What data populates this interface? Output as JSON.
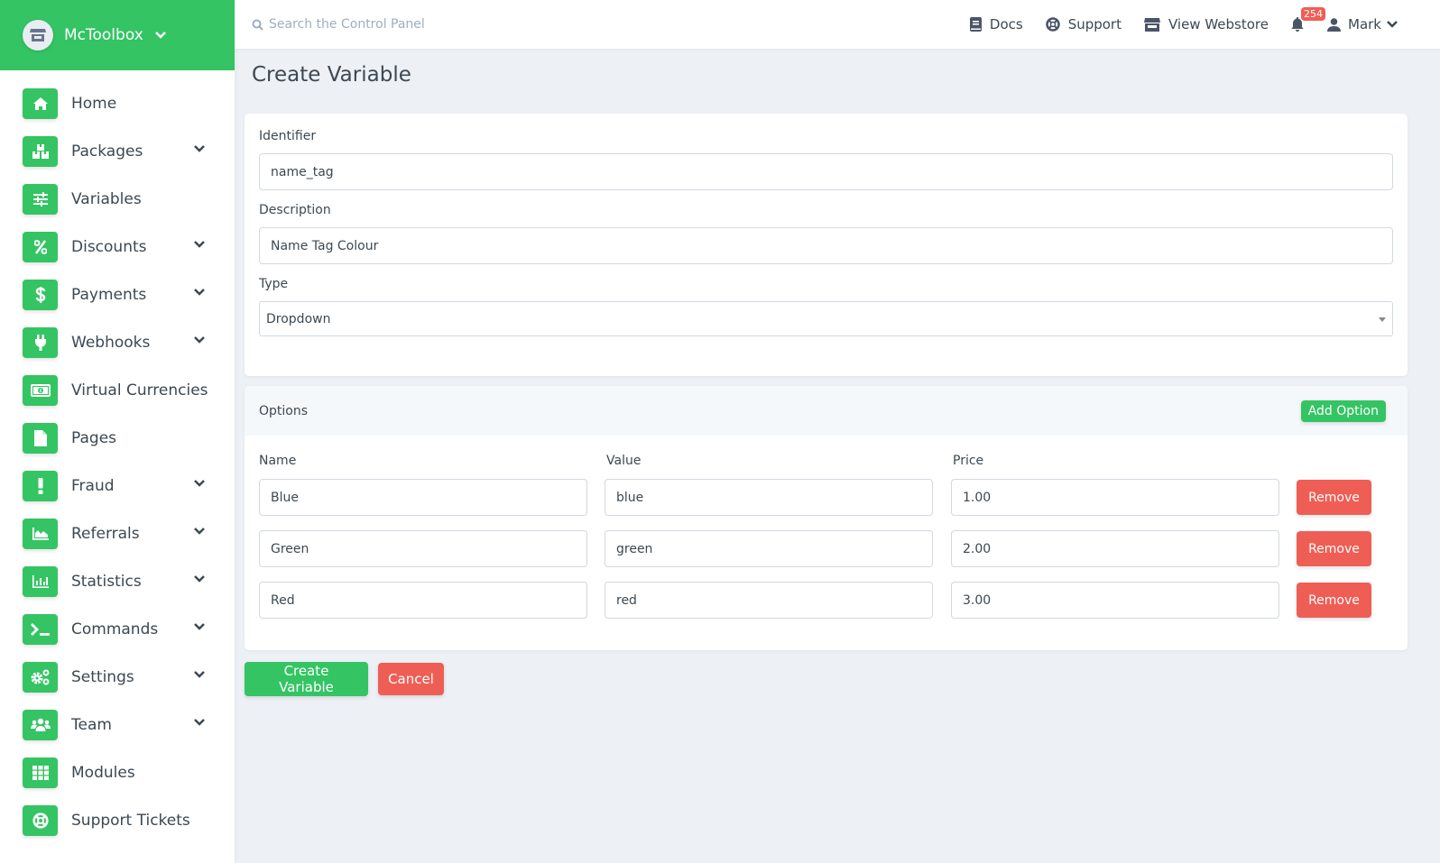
{
  "brand": {
    "name": "McToolbox",
    "color": "#34c463"
  },
  "sidebar": {
    "items": [
      {
        "label": "Home",
        "icon": "home-icon",
        "expandable": false
      },
      {
        "label": "Packages",
        "icon": "boxes-icon",
        "expandable": true
      },
      {
        "label": "Variables",
        "icon": "sliders-icon",
        "expandable": false
      },
      {
        "label": "Discounts",
        "icon": "percent-icon",
        "expandable": true
      },
      {
        "label": "Payments",
        "icon": "dollar-icon",
        "expandable": true
      },
      {
        "label": "Webhooks",
        "icon": "plug-icon",
        "expandable": true
      },
      {
        "label": "Virtual Currencies",
        "icon": "money-bill-icon",
        "expandable": false
      },
      {
        "label": "Pages",
        "icon": "file-icon",
        "expandable": false
      },
      {
        "label": "Fraud",
        "icon": "exclamation-icon",
        "expandable": true
      },
      {
        "label": "Referrals",
        "icon": "area-chart-icon",
        "expandable": true
      },
      {
        "label": "Statistics",
        "icon": "bar-chart-icon",
        "expandable": true
      },
      {
        "label": "Commands",
        "icon": "terminal-icon",
        "expandable": true
      },
      {
        "label": "Settings",
        "icon": "cogs-icon",
        "expandable": true
      },
      {
        "label": "Team",
        "icon": "users-icon",
        "expandable": true
      },
      {
        "label": "Modules",
        "icon": "grid-icon",
        "expandable": false
      },
      {
        "label": "Support Tickets",
        "icon": "life-ring-icon",
        "expandable": false
      }
    ]
  },
  "topbar": {
    "search_placeholder": "Search the Control Panel",
    "links": [
      {
        "label": "Docs",
        "icon": "book-icon"
      },
      {
        "label": "Support",
        "icon": "life-ring-icon"
      },
      {
        "label": "View Webstore",
        "icon": "store-icon"
      }
    ],
    "notifications_count": "254",
    "user_name": "Mark"
  },
  "page": {
    "title": "Create Variable",
    "form": {
      "identifier_label": "Identifier",
      "identifier_value": "name_tag",
      "description_label": "Description",
      "description_value": "Name Tag Colour",
      "type_label": "Type",
      "type_value": "Dropdown"
    },
    "options": {
      "title": "Options",
      "add_label": "Add Option",
      "headers": {
        "name": "Name",
        "value": "Value",
        "price": "Price"
      },
      "remove_label": "Remove",
      "rows": [
        {
          "name": "Blue",
          "value": "blue",
          "price": "1.00"
        },
        {
          "name": "Green",
          "value": "green",
          "price": "2.00"
        },
        {
          "name": "Red",
          "value": "red",
          "price": "3.00"
        }
      ]
    },
    "create_label": "Create Variable",
    "cancel_label": "Cancel"
  },
  "colors": {
    "accent": "#34c463",
    "danger": "#ef5e55",
    "background": "#edf1f5",
    "text": "#3d4852"
  }
}
